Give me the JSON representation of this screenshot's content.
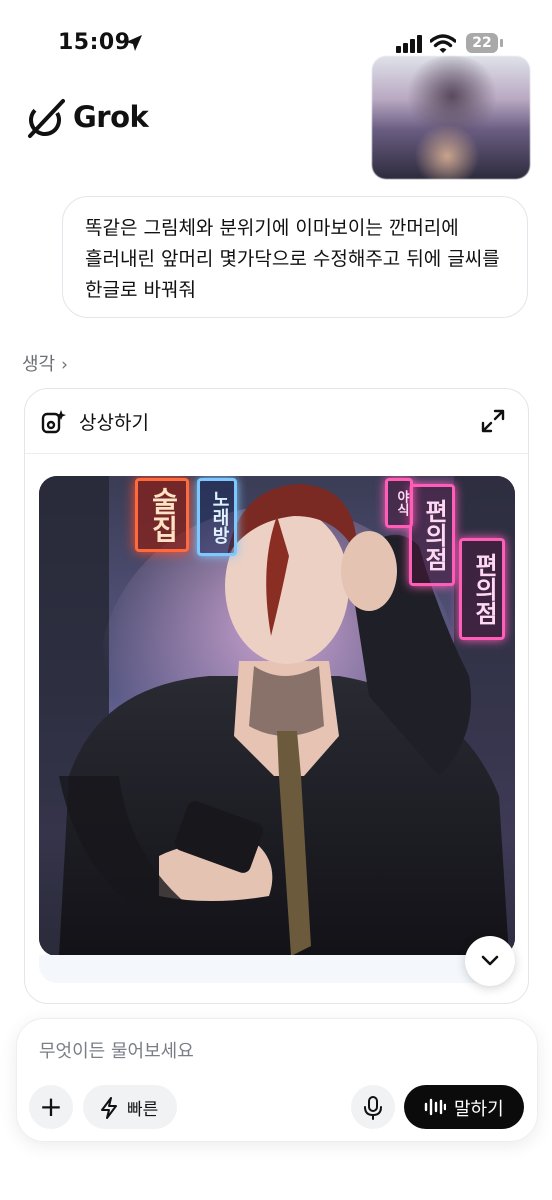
{
  "status_bar": {
    "time": "15:09",
    "battery": "22"
  },
  "header": {
    "brand": "Grok"
  },
  "user_message": {
    "text": "똑같은 그림체와 분위기에 이마보이는 깐머리에\n흘러내린 앞머리 몇가닥으로 수정해주고 뒤에 글씨를\n한글로 바꿔줘"
  },
  "thinking": {
    "label": "생각",
    "chevron": "›"
  },
  "imagine_card": {
    "title": "상상하기",
    "image_signs": {
      "sign_1": "술집",
      "sign_2": "노래방",
      "sign_3": "편의점",
      "sign_4": "편의점",
      "sign_5": "야식"
    }
  },
  "composer": {
    "placeholder": "무엇이든 물어보세요",
    "fast_label": "빠른",
    "speak_label": "말하기"
  },
  "icons": {
    "location": "location-arrow-icon",
    "signal": "cellular-signal-icon",
    "wifi": "wifi-icon",
    "logo": "grok-logo-icon",
    "imagine": "imagine-sparkle-icon",
    "expand": "expand-icon",
    "scroll": "chevron-down-icon",
    "plus": "plus-icon",
    "bolt": "lightning-bolt-icon",
    "mic": "microphone-icon",
    "waveform": "waveform-icon"
  }
}
